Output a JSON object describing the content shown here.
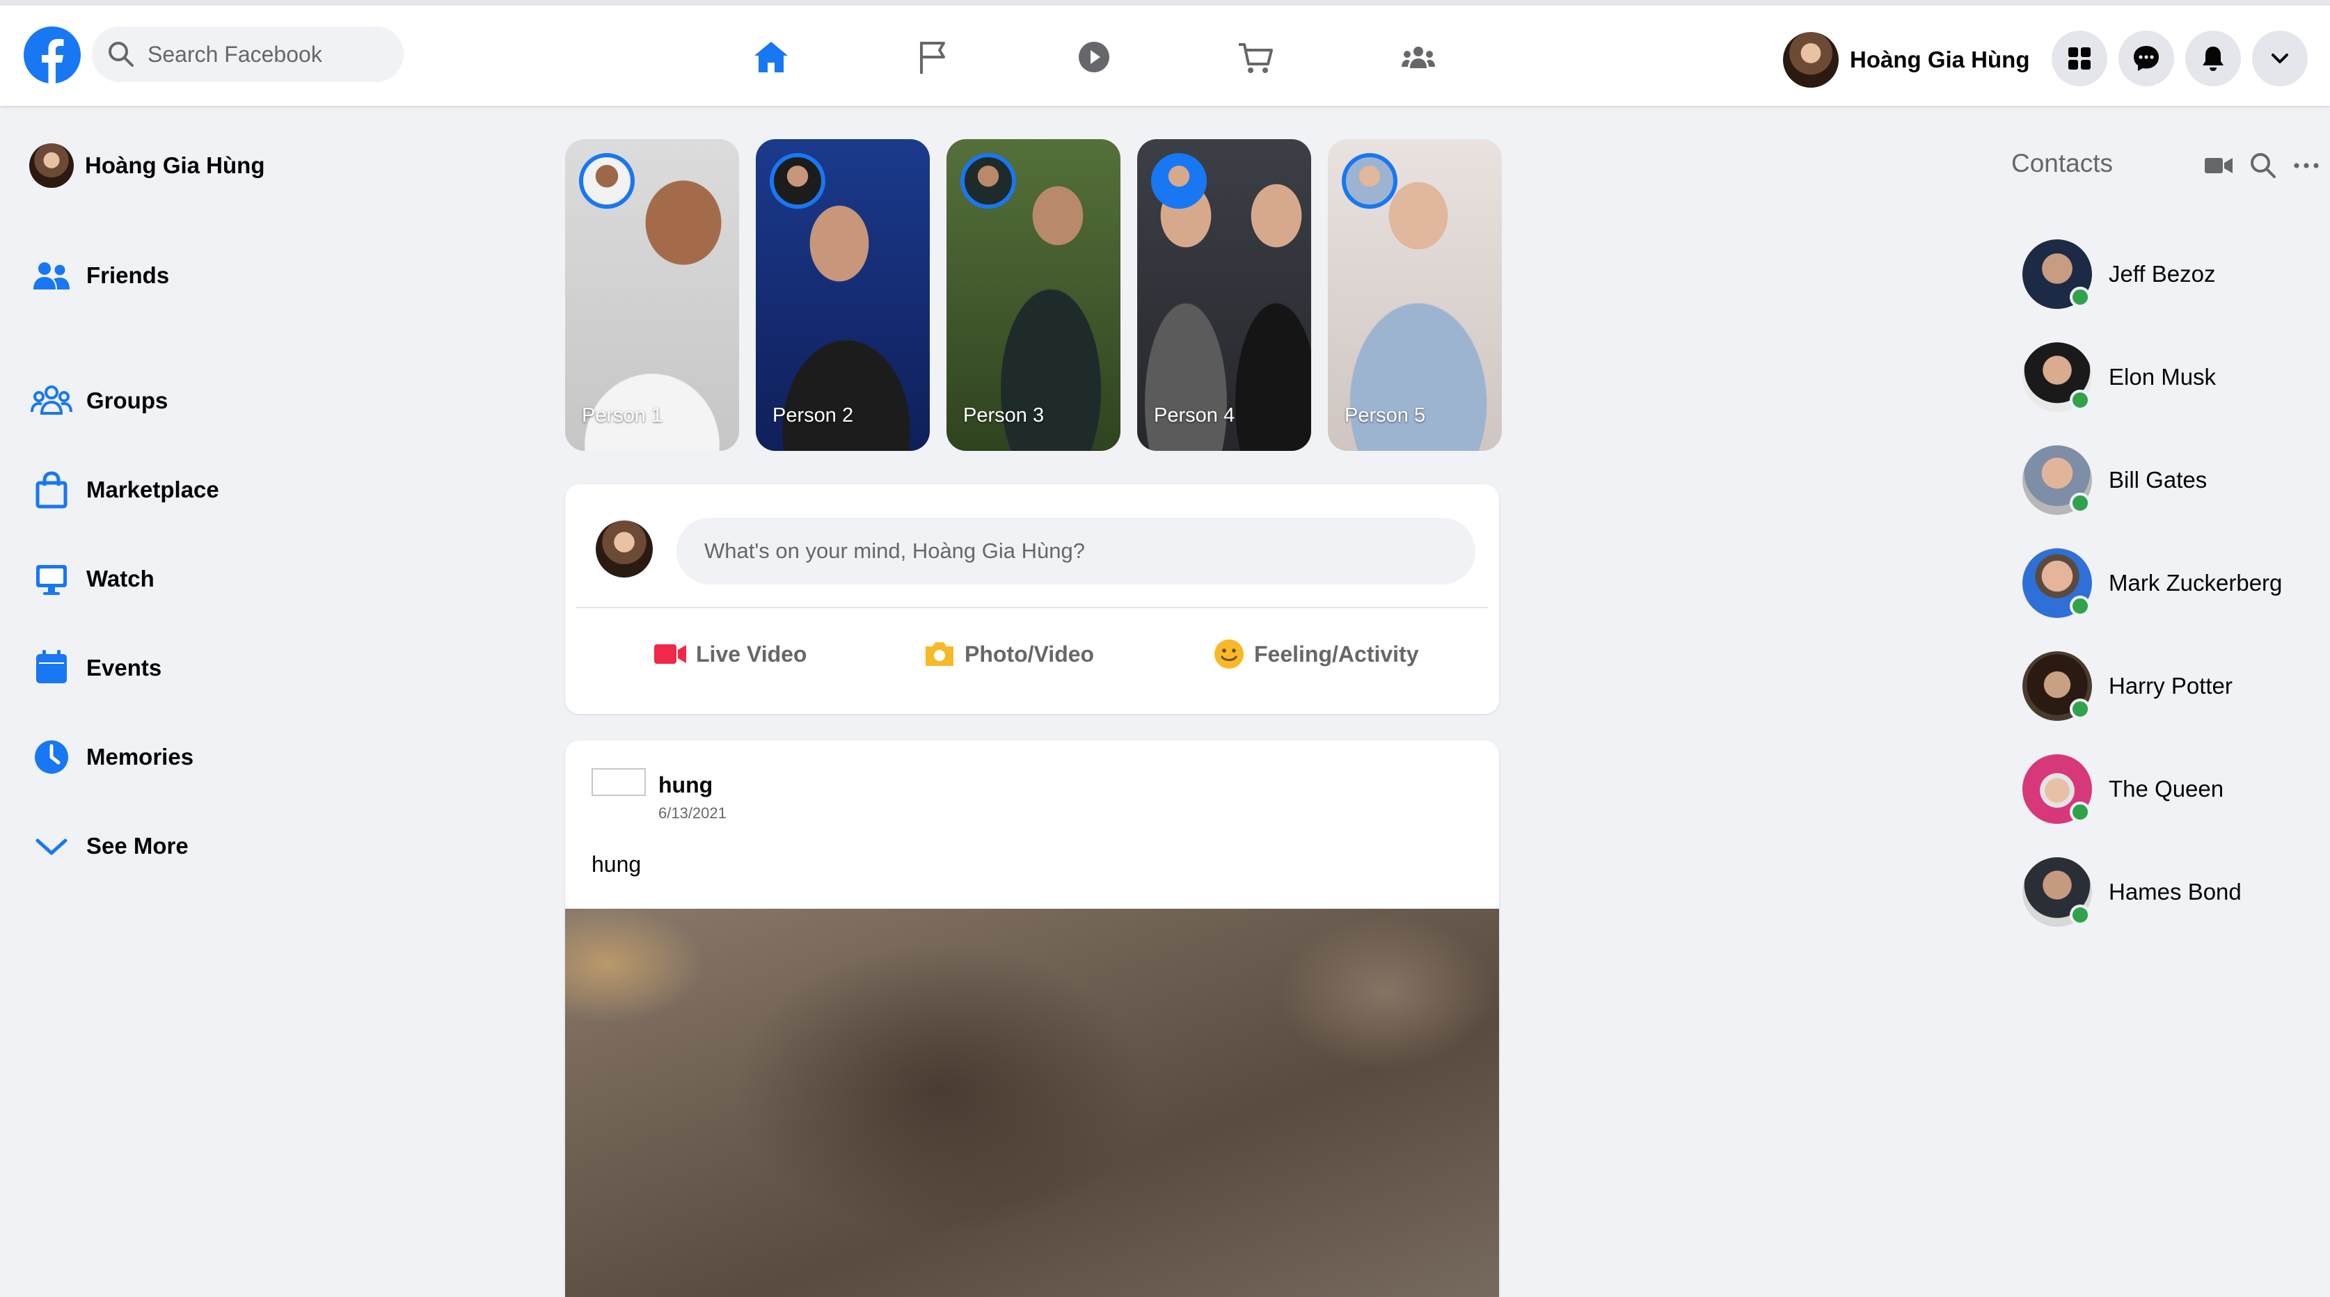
{
  "header": {
    "search_placeholder": "Search Facebook",
    "nav": [
      "home-icon",
      "flag-icon",
      "watch-icon",
      "marketplace-icon",
      "groups-icon"
    ],
    "active_nav": "home",
    "profile_name": "Hoàng Gia Hùng",
    "actions": [
      "menu-grid-icon",
      "messenger-icon",
      "bell-icon",
      "chevron-down-icon"
    ]
  },
  "sidebar": {
    "profile_name": "Hoàng Gia Hùng",
    "items": [
      {
        "label": "Friends",
        "icon": "friends-icon"
      },
      {
        "label": "Groups",
        "icon": "groups-icon"
      },
      {
        "label": "Marketplace",
        "icon": "shopping-bag-icon"
      },
      {
        "label": "Watch",
        "icon": "monitor-icon"
      },
      {
        "label": "Events",
        "icon": "calendar-icon"
      },
      {
        "label": "Memories",
        "icon": "clock-icon"
      },
      {
        "label": "See More",
        "icon": "chevron-down-icon"
      }
    ]
  },
  "stories": [
    {
      "name": "Person 1"
    },
    {
      "name": "Person 2"
    },
    {
      "name": "Person 3"
    },
    {
      "name": "Person 4"
    },
    {
      "name": "Person 5"
    }
  ],
  "composer": {
    "placeholder": "What's  on your mind, Hoàng Gia Hùng?",
    "actions": [
      {
        "label": "Live Video",
        "icon": "live-video-icon",
        "color": "#f02849"
      },
      {
        "label": "Photo/Video",
        "icon": "photo-icon",
        "color": "#f7b928"
      },
      {
        "label": "Feeling/Activity",
        "icon": "smiley-icon",
        "color": "#f7b928"
      }
    ]
  },
  "post": {
    "author": "hung",
    "date": "6/13/2021",
    "text": "hung"
  },
  "contacts": {
    "title": "Contacts",
    "items": [
      {
        "name": "Jeff Bezoz",
        "online": true
      },
      {
        "name": "Elon Musk",
        "online": true
      },
      {
        "name": "Bill Gates",
        "online": true
      },
      {
        "name": "Mark Zuckerberg",
        "online": true
      },
      {
        "name": "Harry Potter",
        "online": true
      },
      {
        "name": "The Queen",
        "online": true
      },
      {
        "name": "Hames Bond",
        "online": true
      }
    ]
  },
  "colors": {
    "brand": "#1877f2",
    "background": "#f0f2f5",
    "online": "#31a24c"
  }
}
